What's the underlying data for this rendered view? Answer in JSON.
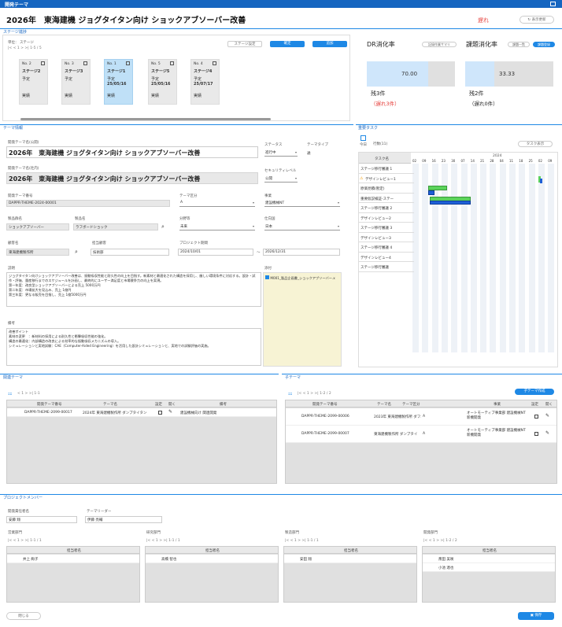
{
  "app_title": "開発テーマ",
  "header": {
    "theme_title": "2026年　東海建機 ジョグタイタン向け ショックアブソーバー改善",
    "status_text": "遅れ",
    "refresh_label": "表示更新",
    "colors": {
      "status": "#e53935",
      "accent": "#1e88e5"
    }
  },
  "stage": {
    "section_label": "ステージ進捗",
    "unit_label": "単位：",
    "unit_value": "ステージ",
    "pager": "|<  <   1   >  >|  1-5 / 5",
    "settings_button": "ステージ設定",
    "confirm_button": "確定",
    "add_button": "追加",
    "cards": [
      {
        "no": "No. 2",
        "name": "ステージ2",
        "plan": "予定",
        "date": "",
        "actual": "実績",
        "active": false
      },
      {
        "no": "No. 3",
        "name": "ステージ3",
        "plan": "予定",
        "date": "",
        "actual": "実績",
        "active": false
      },
      {
        "no": "No. 1",
        "name": "ステージ1",
        "plan": "予定",
        "date": "25/05/16",
        "actual": "実績",
        "active": true
      },
      {
        "no": "No. 5",
        "name": "ステージ5",
        "plan": "予定",
        "date": "25/05/16",
        "actual": "実績",
        "active": false
      },
      {
        "no": "No. 4",
        "name": "ステージ4",
        "plan": "予定",
        "date": "25/07/17",
        "actual": "実績",
        "active": false
      }
    ]
  },
  "dr": {
    "title": "DR消化率",
    "summary_button": "記録作業サマリ",
    "value": "70.00",
    "progress": 0.7,
    "remaining": "残3件",
    "delayed": "（遅れ3件）"
  },
  "issue": {
    "title": "課題消化率",
    "list_button": "課題一覧",
    "register_button": "課題登録",
    "value": "33.33",
    "progress": 0.3333,
    "remaining": "残2件",
    "delayed": "（遅れ0件）"
  },
  "theme_info": {
    "section_label": "テーマ情報",
    "name_public_label": "開発テーマ名(公開)",
    "name_public": "2026年　東海建機 ジョグタイタン向け ショックアブソーバー改善",
    "name_internal_label": "開発テーマ名(社内)",
    "name_internal": "2026年　東海建機 ジョグタイタン向け ショックアブソーバー改善",
    "status_label": "ステータス",
    "status_value": "進行中",
    "type_label": "テーマタイプ",
    "type_value": "通",
    "security_label": "セキュリティレベル",
    "security_value": "公開",
    "number_label": "開発テーマ番号",
    "number_value": "DAPPR-THEME-2024-00001",
    "division_label": "テーマ区分",
    "division_value": "A",
    "business_label": "事業",
    "business_value": "建設機械NT",
    "product_group_label": "製品群名",
    "product_group_value": "ショックアブソーバー",
    "product_label": "製品名",
    "product_value": "ラフボードショック",
    "category_label": "分野等",
    "category_value": "未来",
    "country_label": "仕向国",
    "country_value": "日本",
    "customer_label": "顧客名",
    "customer_value": "東海建機製作所",
    "contact_label": "担当顧客",
    "contact_value": "技術部",
    "period_label": "プロジェクト期間",
    "period_from": "2024/10/01",
    "period_sep": "～",
    "period_to": "2026/12/31",
    "description_label": "説明",
    "description": "ジョグタイタン向けショックアブソーバー改善は、振動吸収性能と耐久性の向上を目指す。新素材と最適化された構造を採用し、厳しい環境条件に対応する。設計・試作・評価、量産移行までのスケジュールを計画し、最終的にユーザー満足度と市場競争力の向上を実現。\n第一年度：改良型ショックアブソーバーによる売上 5000万円\n第二年度：市場拡大を見込み、売上 1億円\n第三年度：更なる販売を目指し、売上 1億5000万円",
    "attachment_label": "添付",
    "attachment_file": "M001_製品企画書_ショックアブソーバー.x",
    "remarks_label": "備考",
    "remarks": "改善ポイント\n素材の変更　：新材料の採用による耐久性と衝撃吸収性能の強化。\n構造の最適化：内部構造の改良による効率的な振動吸収メカニズムの導入。\nシミュレーションと実地試験：CAE（Computer-Aided Engineering）を活用した設計シミュレーションと、実地での試験評価の実施。"
  },
  "task": {
    "section_label": "重要タスク",
    "today_label": "今日",
    "row_count": "行数(11)",
    "task_display_button": "タスク表示",
    "column_header": "タスク名",
    "year": "2024",
    "months": [
      "02",
      "09",
      "16",
      "23",
      "30",
      "07",
      "14",
      "21",
      "28",
      "04",
      "11",
      "18",
      "25",
      "02",
      "09"
    ],
    "rows": [
      "ステージ移行審議 1",
      "デザインレビュー1",
      "原価見積(暫定)",
      "重要仮説検証-ステー",
      "ステージ移行審議 2",
      "デザインレビュー2",
      "ステージ移行審議 3",
      "デザインレビュー3",
      "ステージ移行審議 4",
      "デザインレビュー4",
      "ステージ移行審議"
    ]
  },
  "related": {
    "section_label": "関連テーマ",
    "pager": "<   1   >  >|  1-1",
    "headers": [
      "開発テーマ番号",
      "テーマ名",
      "設定",
      "開く",
      "備考"
    ],
    "rows": [
      {
        "number": "DAPPR-THEME-2099-00017",
        "name": "2024年 東海建機製作所 ダンプタイタン",
        "remark": "建設機械向け 関連開発"
      }
    ]
  },
  "child": {
    "section_label": "子テーマ",
    "pager": "|<  <   1   >  >|  1-2 / 2",
    "create_button": "子テーマ作成",
    "headers": [
      "開発テーマ番号",
      "テーマ名",
      "テーマ区分",
      "事業",
      "設定",
      "開く"
    ],
    "rows": [
      {
        "number": "DAPPR-THEME-2099-00006",
        "name": "2023年 東海建機製作所 ダフエクス",
        "division": "A",
        "business": "オートモーティブ事業部 建設機械NT 新機開発"
      },
      {
        "number": "DAPPR-THEME-2099-00007",
        "name": "東海建機製作所 ダンプタイ",
        "division": "A",
        "business": "オートモーティブ事業部 建設機械NT 新機開発"
      }
    ]
  },
  "members": {
    "section_label": "プロジェクトメンバー",
    "dev_manager_label": "開発責任者名",
    "dev_manager_value": "安藤 翔",
    "leader_label": "テーマリーダー",
    "leader_value": "伊藤 亮輔",
    "column_header": "担当者名",
    "groups": [
      {
        "label": "営業部門",
        "pager": "|<  <   1   >  >|  1-1 / 1",
        "members": [
          "井上 絢子"
        ]
      },
      {
        "label": "研究部門",
        "pager": "|<  <   1   >  >|  1-1 / 1",
        "members": [
          "高橋 智也"
        ]
      },
      {
        "label": "製造部門",
        "pager": "|<  <   1   >  >|  1-1 / 1",
        "members": [
          "安田 翔"
        ]
      },
      {
        "label": "開発部門",
        "pager": "|<  <   1   >  >|  1-2 / 2",
        "members": [
          "斎田 美咲",
          "小池 達也"
        ]
      }
    ]
  },
  "footer": {
    "close_button": "閉じる",
    "save_button": "保存"
  }
}
